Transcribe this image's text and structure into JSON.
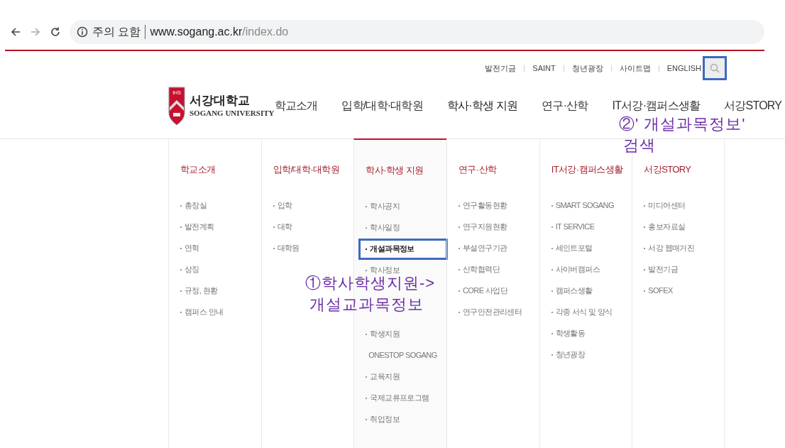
{
  "browser": {
    "security_label": "주의 요함",
    "url_host": "www.sogang.ac.kr",
    "url_path": "/index.do"
  },
  "top_links": [
    "발전기금",
    "SAINT",
    "청년광장",
    "사이트맵",
    "ENGLISH"
  ],
  "search_button": {
    "highlighted": true
  },
  "logo": {
    "korean": "서강대학교",
    "english": "SOGANG UNIVERSITY",
    "crest": "IHS"
  },
  "nav": [
    {
      "label": "학교소개",
      "selected": false
    },
    {
      "label": "입학/대학·대학원",
      "selected": false
    },
    {
      "label": "학사·학생 지원",
      "selected": true
    },
    {
      "label": "연구·산학",
      "selected": false
    },
    {
      "label": "IT서강·캠퍼스생활",
      "selected": false
    },
    {
      "label": "서강STORY",
      "selected": false
    }
  ],
  "menu_columns": [
    {
      "heading": "학교소개",
      "items": [
        {
          "label": "총장실",
          "highlighted": false
        },
        {
          "label": "발전계획",
          "highlighted": false
        },
        {
          "label": "연혁",
          "highlighted": false
        },
        {
          "label": "상징",
          "highlighted": false
        },
        {
          "label": "규정, 현황",
          "highlighted": false
        },
        {
          "label": "캠퍼스 안내",
          "highlighted": false
        }
      ]
    },
    {
      "heading": "입학/대학·대학원",
      "items": [
        {
          "label": "입학",
          "highlighted": false
        },
        {
          "label": "대학",
          "highlighted": false
        },
        {
          "label": "대학원",
          "highlighted": false
        }
      ]
    },
    {
      "heading": "학사·학생 지원",
      "items": [
        {
          "label": "학사공지",
          "highlighted": false
        },
        {
          "label": "학사일정",
          "highlighted": false
        },
        {
          "label": "개설과목정보",
          "highlighted": true
        },
        {
          "label": "학사정보",
          "highlighted": false
        },
        {
          "kind": "covered"
        },
        {
          "kind": "covered"
        },
        {
          "label": "학생지원",
          "highlighted": false
        },
        {
          "label": "ONESTOP SOGANG",
          "highlighted": false
        },
        {
          "label": "교육지원",
          "highlighted": false
        },
        {
          "label": "국제교류프로그램",
          "highlighted": false
        },
        {
          "label": "취업정보",
          "highlighted": false
        }
      ]
    },
    {
      "heading": "연구·산학",
      "items": [
        {
          "label": "연구활동현황",
          "highlighted": false
        },
        {
          "label": "연구지원현황",
          "highlighted": false
        },
        {
          "label": "부설연구기관",
          "highlighted": false
        },
        {
          "label": "산학협력단",
          "highlighted": false
        },
        {
          "label": "CORE 사업단",
          "highlighted": false
        },
        {
          "label": "연구안전관리센터",
          "highlighted": false
        }
      ]
    },
    {
      "heading": "IT서강·캠퍼스생활",
      "items": [
        {
          "label": "SMART SOGANG",
          "highlighted": false
        },
        {
          "label": "IT SERVICE",
          "highlighted": false
        },
        {
          "label": "세인트포털",
          "highlighted": false
        },
        {
          "label": "사이버캠퍼스",
          "highlighted": false
        },
        {
          "label": "캠퍼스생활",
          "highlighted": false
        },
        {
          "label": "각종 서식 및 양식",
          "highlighted": false
        },
        {
          "label": "학생활동",
          "highlighted": false
        },
        {
          "label": "청년광장",
          "highlighted": false
        }
      ]
    },
    {
      "heading": "서강STORY",
      "items": [
        {
          "label": "미디어센터",
          "highlighted": false
        },
        {
          "label": "홍보자료실",
          "highlighted": false
        },
        {
          "label": "서강 웹매거진",
          "highlighted": false
        },
        {
          "label": "발전기금",
          "highlighted": false
        },
        {
          "label": "SOFEX",
          "highlighted": false
        }
      ]
    }
  ],
  "annotations": [
    {
      "lines": [
        "①학사학생지원->",
        "개설교과목정보"
      ]
    },
    {
      "lines": [
        "②' 개설과목정보'",
        "검색"
      ]
    }
  ]
}
